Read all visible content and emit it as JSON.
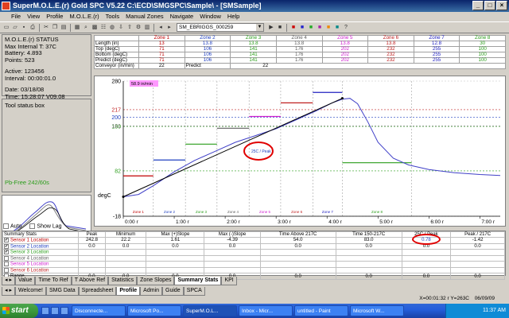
{
  "window": {
    "title": "SuperM.O.L.E.(r) Gold SPC V5.22  C:\\ECD\\SMGSPC\\Sample\\ - [SMSample]",
    "minimize": "_",
    "maximize": "□",
    "close": "×"
  },
  "menu": [
    "File",
    "View",
    "Profile",
    "M.O.L.E.(r)",
    "Tools",
    "Manual Zones",
    "Navigate",
    "Window",
    "Help"
  ],
  "toolbar": {
    "combo_value": "SM_EBRIGGS_000259"
  },
  "status": {
    "header": "M.O.L.E.(r) STATUS",
    "max_internal": "Max Internal T: 37C",
    "battery": "Battery: 4.893",
    "points": "Points: 523",
    "active": "Active: 123456",
    "interval": "Interval: 00:00:01.0",
    "date": "Date: 03/18/08",
    "time": "Time: 15:28:07  V09.08"
  },
  "tool_status": {
    "header": "Tool status box",
    "profile": "Pb-Free 242/60s"
  },
  "checks": {
    "auto": "Auto",
    "show_lag": "Show Lag"
  },
  "zones": {
    "headers": [
      "Zone 1",
      "Zone 2",
      "Zone 3",
      "Zone 4",
      "Zone 5",
      "Zone 6",
      "Zone 7",
      "Zone 8"
    ],
    "header_colors": [
      "#c00000",
      "#2040c0",
      "#2a9d1a",
      "#606060",
      "#d020d0",
      "#c02020",
      "#2020c0",
      "#2a9d1a"
    ],
    "rows": [
      {
        "label": "Length (in)",
        "values": [
          "13",
          "13.8",
          "13.8",
          "13.8",
          "13.8",
          "13.8",
          "12.8",
          "30"
        ]
      },
      {
        "label": "Top (degC)",
        "values": [
          "71",
          "106",
          "141",
          "176",
          "202",
          "232",
          "255",
          "100"
        ]
      },
      {
        "label": "Bottom (degC)",
        "values": [
          "71",
          "106",
          "141",
          "176",
          "202",
          "232",
          "255",
          "100"
        ]
      },
      {
        "label": "Predict (degC)",
        "values": [
          "71",
          "106",
          "141",
          "176",
          "202",
          "232",
          "255",
          "100"
        ]
      }
    ],
    "conveyor_label": "Conveyor (in/min)",
    "conveyor_value": "22",
    "predict_label": "Predict",
    "predict_value": "22"
  },
  "chart_data": {
    "type": "line",
    "ylabel": "degC",
    "yticks": [
      -18,
      82,
      180,
      181,
      200,
      217,
      280
    ],
    "ylim": [
      -18,
      280
    ],
    "xticks": [
      "0:00 r",
      "1:00 r",
      "2:00 r",
      "3:00 r",
      "4:00 r",
      "5:00 r",
      "6:00 r",
      "7:00 r"
    ],
    "xlim": [
      0,
      7.4
    ],
    "speed_badge": "58.9 in/min",
    "peak_label": "25C / Peak",
    "zone_labels": [
      "Zone 1",
      "Zone 2",
      "Zone 3",
      "Zone 4",
      "Zone 5",
      "Zone 6",
      "Zone 7",
      "Zone 8"
    ],
    "zone_bounds": [
      0,
      0.59,
      1.22,
      1.84,
      2.47,
      3.09,
      3.72,
      4.3,
      5.66
    ],
    "zone_setpoints": [
      71,
      106,
      141,
      176,
      202,
      232,
      255,
      100
    ],
    "series": [
      {
        "color": "#4040c8",
        "x": [
          0,
          0.3,
          0.6,
          1.0,
          1.4,
          1.8,
          2.2,
          2.6,
          3.0,
          3.4,
          3.8,
          4.1,
          4.3,
          4.45,
          4.6,
          4.8,
          5.0,
          5.3,
          5.6,
          6.0,
          6.5,
          7.0,
          7.4
        ],
        "y": [
          25,
          30,
          50,
          80,
          105,
          125,
          145,
          160,
          175,
          195,
          215,
          232,
          240,
          242,
          230,
          190,
          145,
          110,
          95,
          85,
          78,
          74,
          72
        ]
      },
      {
        "color": "#000000",
        "x": [
          0,
          4.3
        ],
        "y": [
          25,
          242
        ]
      }
    ]
  },
  "stats": {
    "headers": [
      "Summary Stats",
      "Peak",
      "Minimum",
      "Max (+)Slope",
      "Max (-)Slope",
      "Time Above 217C",
      "Time 150-217C",
      "25C / Peak",
      "Peak / 217C"
    ],
    "rows": [
      {
        "label": "Sensor 1 Location",
        "values": [
          "242.8",
          "22.2",
          "1.61",
          "-4.39",
          "54.0",
          "83.0",
          "0.78",
          "-1.42"
        ],
        "color": "#c00000",
        "checked": true
      },
      {
        "label": "Sensor 2 Location",
        "values": [
          "0.0",
          "0.0",
          "0.0",
          "0.0",
          "0.0",
          "0.0",
          "0.0",
          "0.0"
        ],
        "color": "#2040c0",
        "checked": true
      },
      {
        "label": "Sensor 3 Location",
        "values": [
          "",
          "",
          "",
          "",
          "",
          "",
          "",
          ""
        ],
        "color": "#2a9d1a",
        "checked": true
      },
      {
        "label": "Sensor 4 Location",
        "values": [
          "",
          "",
          "",
          "",
          "",
          "",
          "",
          ""
        ],
        "color": "#606060",
        "checked": false
      },
      {
        "label": "Sensor 5 Location",
        "values": [
          "",
          "",
          "",
          "",
          "",
          "",
          "",
          ""
        ],
        "color": "#d020d0",
        "checked": false
      },
      {
        "label": "Sensor 6 Location",
        "values": [
          "",
          "",
          "",
          "",
          "",
          "",
          "",
          ""
        ],
        "color": "#c02020",
        "checked": false
      },
      {
        "label": "Range",
        "values": [
          "0.0",
          "0.0",
          "0.0",
          "0.0",
          "0.0",
          "0.0",
          "0.0",
          "0.0"
        ],
        "color": "#000000",
        "checked": false
      }
    ]
  },
  "tabs_top": [
    "Value",
    "Time To Ref",
    "T Above Ref",
    "Statistics",
    "Zone Slopes",
    "Summary Stats",
    "KPI"
  ],
  "tabs_top_active": 5,
  "tabs_bottom": [
    "Welcome!",
    "SMG Data",
    "Spreadsheet",
    "Profile",
    "Admin",
    "Guide",
    "SPCA"
  ],
  "tabs_bottom_active": 3,
  "statusbar": {
    "coords": "X=00:01:32 r  Y=263C",
    "date": "06/09/09"
  },
  "taskbar": {
    "start": "start",
    "tasks": [
      "Disconnecte...",
      "Microsoft Po...",
      "SuperM.O.L...",
      "Inbox - Micr...",
      "untitled - Paint",
      "Microsoft W..."
    ],
    "active": 2,
    "clock": "11:37 AM",
    "subclock": "11:37:29"
  },
  "colors": {
    "accent": "#0a246a",
    "peak_circle": "#e00000"
  }
}
